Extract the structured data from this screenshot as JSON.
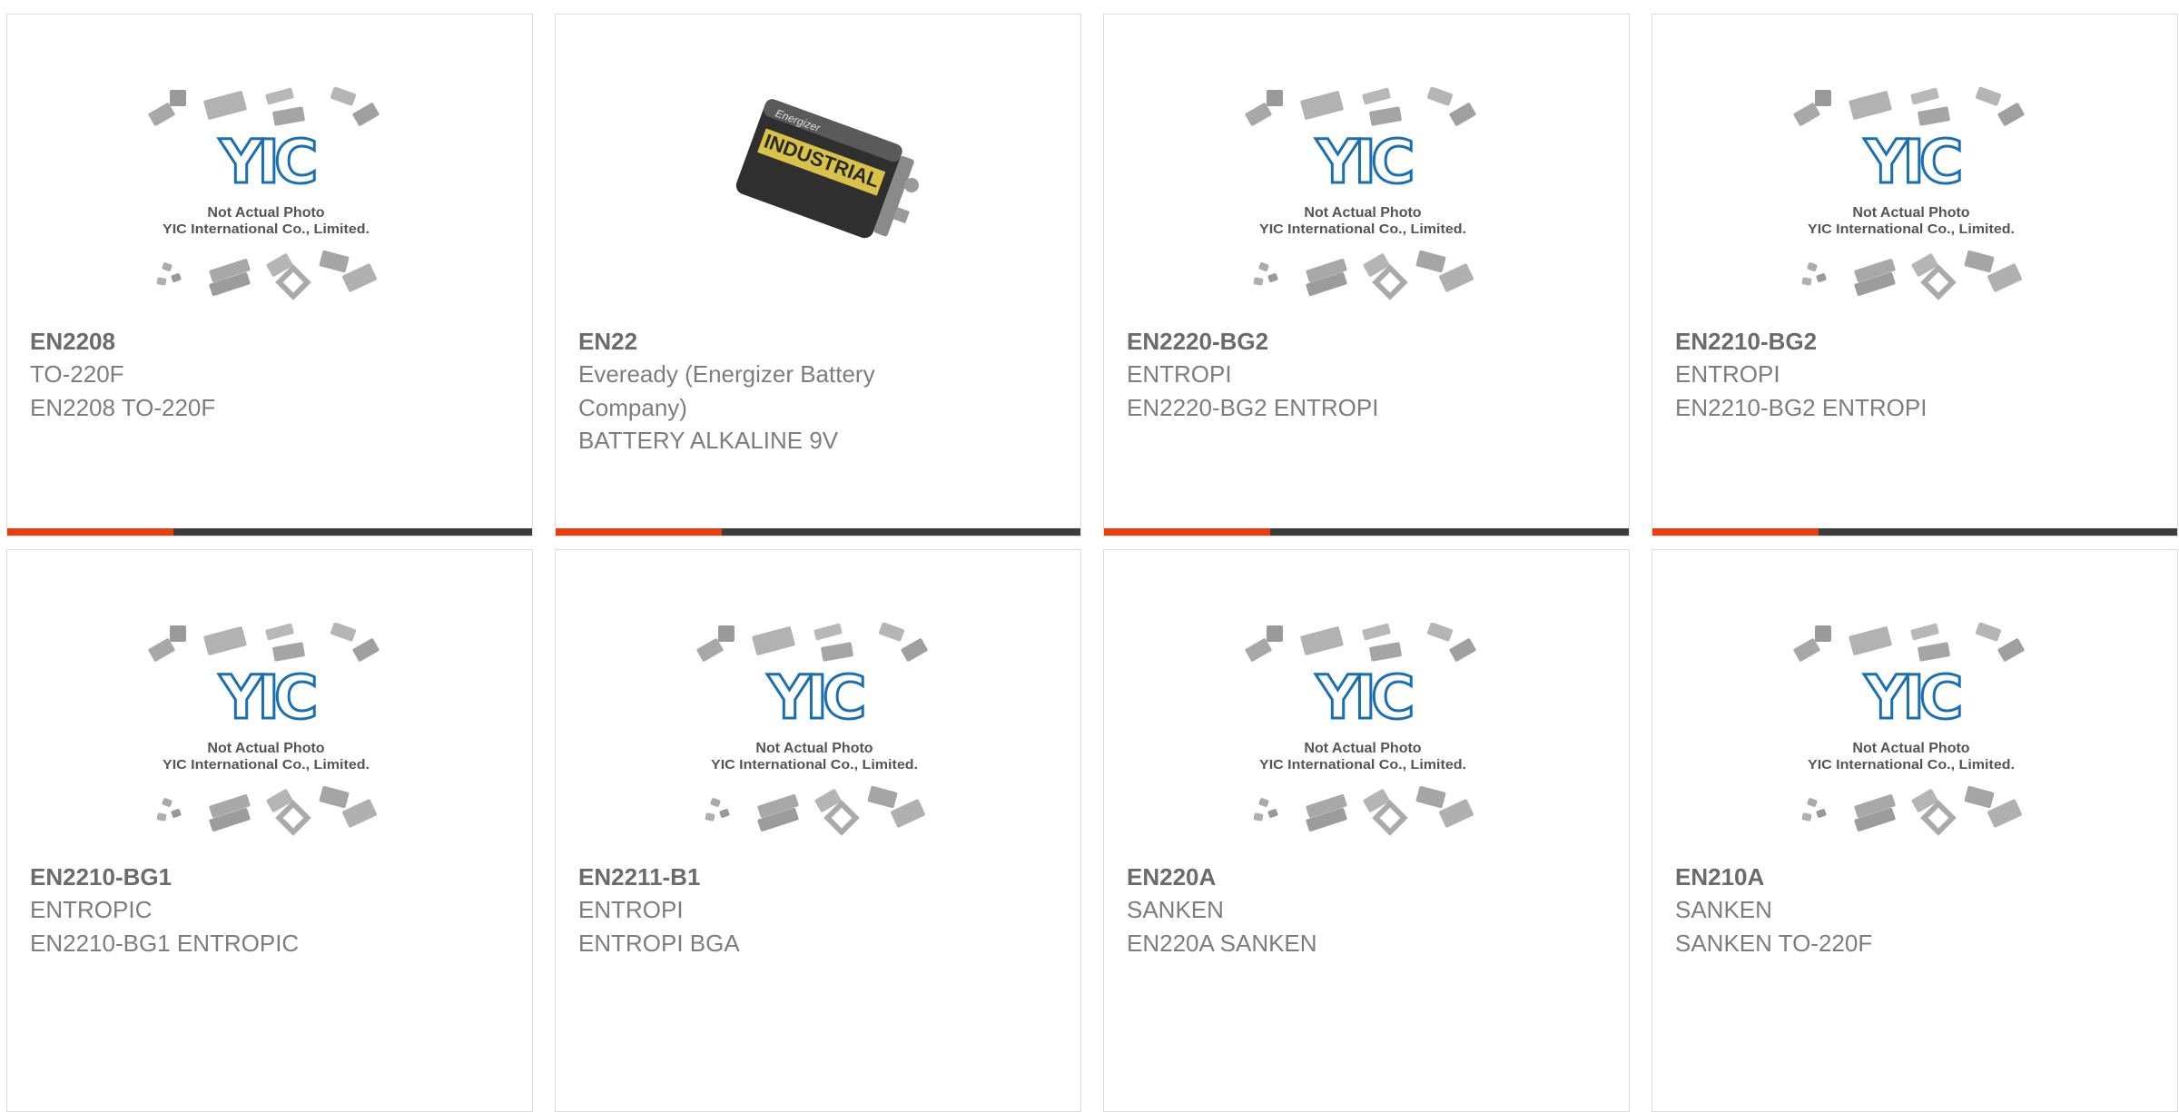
{
  "colors": {
    "accent": "#e63f10",
    "bar": "#3c3c3c",
    "border": "#dcdcdc",
    "title": "#6b6b6b",
    "text": "#7d7d7d",
    "logo": "#1a6fb3"
  },
  "placeholder": {
    "line1": "Not Actual Photo",
    "line2": "YIC International Co., Limited.",
    "logo": "YIC"
  },
  "battery": {
    "brand": "Energizer",
    "label": "INDUSTRIAL"
  },
  "products": [
    {
      "title": "EN2208",
      "lines": [
        "TO-220F",
        "EN2208 TO-220F"
      ],
      "image": "placeholder"
    },
    {
      "title": "EN22",
      "lines": [
        "Eveready (Energizer Battery",
        "Company)",
        "BATTERY ALKALINE 9V"
      ],
      "image": "battery"
    },
    {
      "title": "EN2220-BG2",
      "lines": [
        "ENTROPI",
        "EN2220-BG2 ENTROPI"
      ],
      "image": "placeholder"
    },
    {
      "title": "EN2210-BG2",
      "lines": [
        "ENTROPI",
        "EN2210-BG2 ENTROPI"
      ],
      "image": "placeholder"
    },
    {
      "title": "EN2210-BG1",
      "lines": [
        "ENTROPIC",
        "EN2210-BG1 ENTROPIC"
      ],
      "image": "placeholder"
    },
    {
      "title": "EN2211-B1",
      "lines": [
        "ENTROPI",
        "ENTROPI BGA"
      ],
      "image": "placeholder"
    },
    {
      "title": "EN220A",
      "lines": [
        "SANKEN",
        "EN220A SANKEN"
      ],
      "image": "placeholder"
    },
    {
      "title": "EN210A",
      "lines": [
        "SANKEN",
        "SANKEN TO-220F"
      ],
      "image": "placeholder"
    }
  ]
}
